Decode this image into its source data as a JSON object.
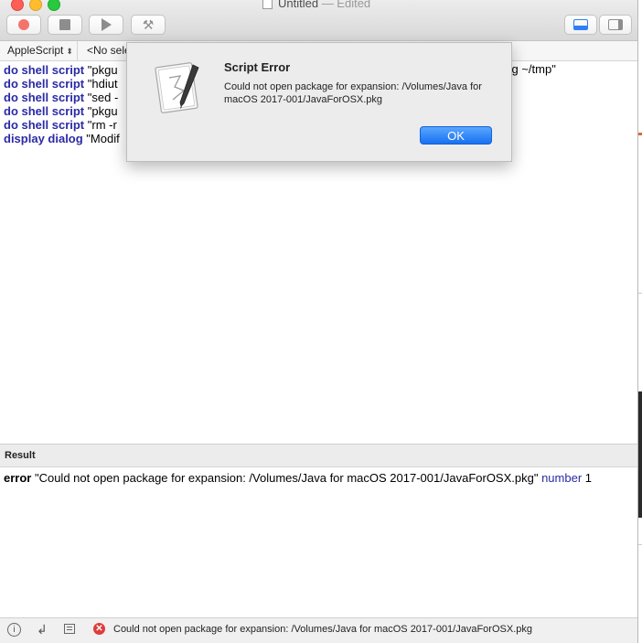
{
  "window": {
    "title": "Untitled",
    "title_suffix": " — Edited"
  },
  "toolbar": {
    "buttons": [
      {
        "name": "record-button",
        "icon": "record-icon"
      },
      {
        "name": "stop-button",
        "icon": "stop-icon"
      },
      {
        "name": "run-button",
        "icon": "play-icon"
      },
      {
        "name": "compile-button",
        "icon": "hammer-icon"
      }
    ],
    "view_buttons": [
      {
        "name": "show-log-button",
        "icon": "bottom-pane-icon",
        "active": true
      },
      {
        "name": "show-sidebar-button",
        "icon": "side-pane-icon",
        "active": false
      }
    ]
  },
  "navbar": {
    "language": "AppleScript",
    "element_selector": "<No sele"
  },
  "editor": {
    "lines": [
      {
        "keyword": "do shell script",
        "text": " \"pkgu"
      },
      {
        "keyword": "do shell script",
        "text": " \"hdiut"
      },
      {
        "keyword": "do shell script",
        "text": " \"sed -"
      },
      {
        "keyword": "do shell script",
        "text": " \"pkgu"
      },
      {
        "keyword": "do shell script",
        "text": " \"rm -r"
      },
      {
        "keyword": "display dialog",
        "text": " \"Modif"
      }
    ],
    "line1_tail": "kg ~/tmp\""
  },
  "dialog": {
    "title": "Script Error",
    "message": "Could not open package for expansion: /Volumes/Java for macOS 2017-001/JavaForOSX.pkg",
    "ok_label": "OK",
    "icon": "script-editor-icon"
  },
  "result": {
    "header": "Result",
    "error_keyword": "error",
    "error_text": " \"Could not open package for expansion: /Volumes/Java for macOS 2017-001/JavaForOSX.pkg\" ",
    "number_keyword": "number",
    "number_value": " 1"
  },
  "statusbar": {
    "message": "Could not open package for expansion: /Volumes/Java for macOS 2017-001/JavaForOSX.pkg"
  },
  "colors": {
    "keyword": "#2a2aa6",
    "accent": "#1870f0",
    "error": "#e03b3b"
  }
}
